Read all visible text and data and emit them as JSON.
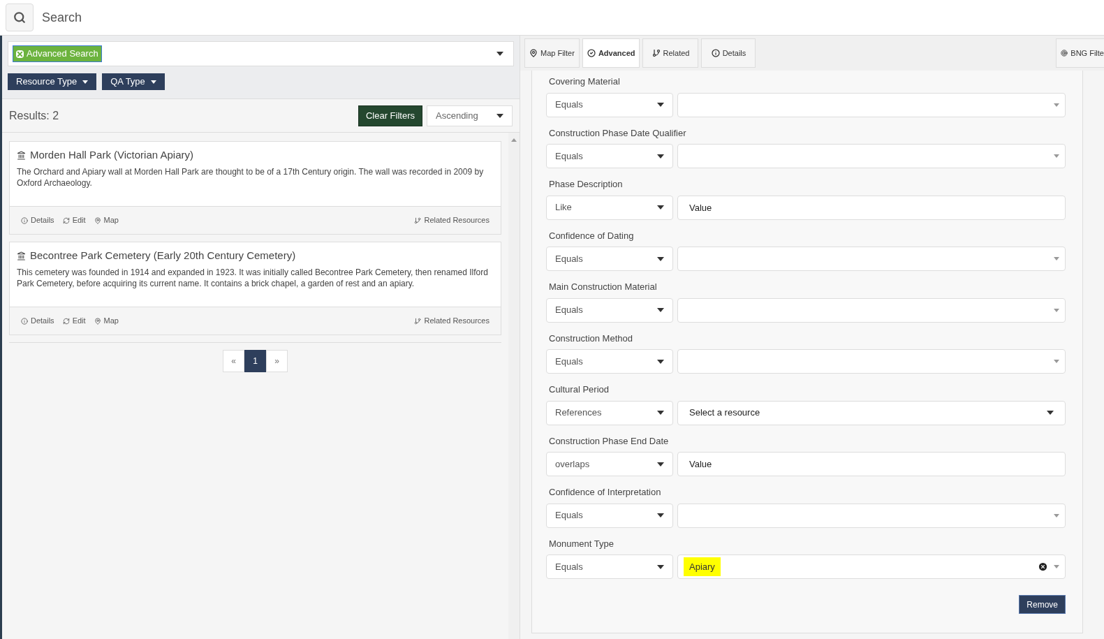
{
  "search": {
    "placeholder": "Search"
  },
  "filter_bar": {
    "chip": "Advanced Search",
    "buttons": [
      "Resource Type",
      "QA Type"
    ]
  },
  "results": {
    "count": "Results: 2",
    "clear": "Clear Filters",
    "sort": "Ascending"
  },
  "cards": [
    {
      "title": "Morden Hall Park (Victorian Apiary)",
      "description": "The Orchard and Apiary wall at Morden Hall Park are thought to be of a 17th Century origin. The wall was recorded in 2009 by Oxford Archaeology.",
      "links": [
        "Details",
        "Edit",
        "Map"
      ],
      "related": "Related Resources"
    },
    {
      "title": "Becontree Park Cemetery (Early 20th Century Cemetery)",
      "description": "This cemetery was founded in 1914 and expanded in 1923. It was initially called Becontree Park Cemetery, then renamed Ilford Park Cemetery, before acquiring its current name. It contains a brick chapel, a garden of rest and an apiary.",
      "links": [
        "Details",
        "Edit",
        "Map"
      ],
      "related": "Related Resources"
    }
  ],
  "pagination": {
    "prev": "«",
    "pages": [
      {
        "label": "1",
        "selected": true
      }
    ],
    "next": "»"
  },
  "tabs": [
    {
      "label": "Map Filter",
      "selected": false
    },
    {
      "label": "Advanced",
      "selected": true
    },
    {
      "label": "Related",
      "selected": false
    },
    {
      "label": "Details",
      "selected": false
    }
  ],
  "bng_tab": "BNG Filte",
  "filters": [
    {
      "label": "Covering Material",
      "operator": "Equals",
      "kind": "select"
    },
    {
      "label": "Construction Phase Date Qualifier",
      "operator": "Equals",
      "kind": "select"
    },
    {
      "label": "Phase Description",
      "operator": "Like",
      "kind": "text",
      "placeholder": "Value"
    },
    {
      "label": "Confidence of Dating",
      "operator": "Equals",
      "kind": "select"
    },
    {
      "label": "Main Construction Material",
      "operator": "Equals",
      "kind": "select"
    },
    {
      "label": "Construction Method",
      "operator": "Equals",
      "kind": "select"
    },
    {
      "label": "Cultural Period",
      "operator": "References",
      "kind": "resource",
      "placeholder": "Select a resource"
    },
    {
      "label": "Construction Phase End Date",
      "operator": "overlaps",
      "kind": "text",
      "placeholder": "Value"
    },
    {
      "label": "Confidence of Interpretation",
      "operator": "Equals",
      "kind": "select"
    },
    {
      "label": "Monument Type",
      "operator": "Equals",
      "kind": "tag",
      "value": "Apiary",
      "highlighted": true
    }
  ],
  "remove": "Remove"
}
